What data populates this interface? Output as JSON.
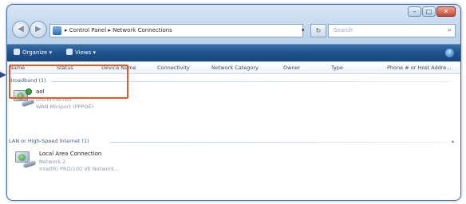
{
  "window": {
    "caption_buttons": {
      "minimize": "–",
      "maximize": "□",
      "close": "✕"
    }
  },
  "address_bar": {
    "back_glyph": "◀",
    "forward_glyph": "▶",
    "path": "▸ Control Panel ▸ Network Connections",
    "dropdown_glyph": "▾",
    "refresh_glyph": "↻"
  },
  "search": {
    "placeholder": "Search",
    "icon": "search-icon"
  },
  "toolbar": {
    "organize_label": "Organize ▾",
    "views_label": "Views ▾",
    "help_glyph": "?"
  },
  "columns": [
    "Name",
    "Status",
    "Device Name",
    "Connectivity",
    "Network Category",
    "Owner",
    "Type",
    "Phone # or Host Addre..."
  ],
  "groups": [
    {
      "header": "Broadband (1)",
      "items": [
        {
          "name": "aol",
          "status": "Disconnected",
          "device": "WAN Miniport (PPPOE)"
        }
      ]
    },
    {
      "header": "LAN or High-Speed Internet (1)",
      "items": [
        {
          "name": "Local Area Connection",
          "status": "Network 2",
          "device": "Intel(R) PRO/100 VE Network..."
        }
      ]
    }
  ],
  "colors": {
    "highlight": "#e05a2a",
    "arrow": "#2b4f86",
    "toolbar": "#20528c"
  }
}
